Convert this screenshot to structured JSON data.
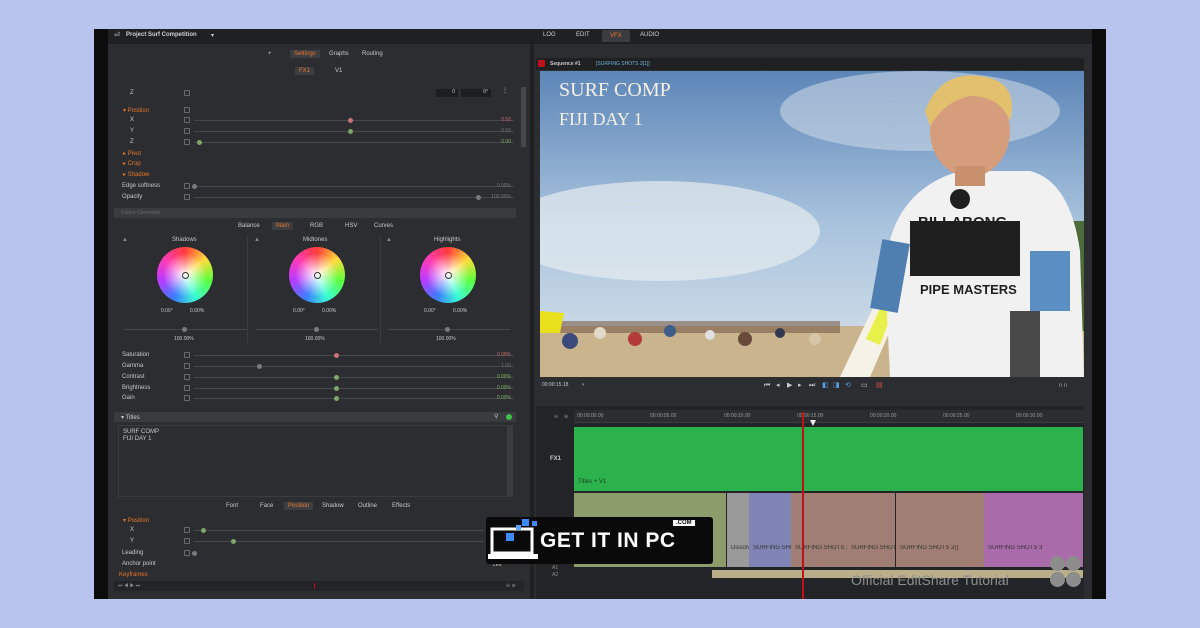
{
  "project_title": "Project Surf Competition",
  "top_tabs": [
    "LOG",
    "EDIT",
    "VFX",
    "AUDIO"
  ],
  "active_top_tab": "VFX",
  "panel_tabs": [
    "Settings",
    "Graphs",
    "Routing"
  ],
  "track_tabs": [
    "FX1",
    "V1"
  ],
  "z_row": {
    "label": "Z",
    "value1": "0",
    "value2": "0°"
  },
  "position_group": {
    "title": "Position",
    "rows": [
      {
        "label": "X",
        "value": "0.50"
      },
      {
        "label": "Y",
        "value": "0.50"
      },
      {
        "label": "Z",
        "value": "0.00"
      }
    ]
  },
  "collapsed_groups": [
    "Pivot",
    "Crop",
    "Shadow"
  ],
  "edge_softness": {
    "label": "Edge softness",
    "value": "0.00%"
  },
  "opacity": {
    "label": "Opacity",
    "value": "100.00%"
  },
  "colour_correction": {
    "title": "Colour Correction",
    "tabs": [
      "Balance",
      "Main",
      "RGB",
      "HSV",
      "Curves"
    ],
    "active_tab": "Main",
    "wheels": [
      {
        "name": "Shadows",
        "angle": "0.00°",
        "amount": "0.00%",
        "level": "100.00%"
      },
      {
        "name": "Midtones",
        "angle": "0.00°",
        "amount": "0.00%",
        "level": "100.00%"
      },
      {
        "name": "Highlights",
        "angle": "0.00°",
        "amount": "0.00%",
        "level": "100.00%"
      }
    ],
    "params": [
      {
        "label": "Saturation",
        "value": "0.00%"
      },
      {
        "label": "Gamma",
        "value": "1.00"
      },
      {
        "label": "Contrast",
        "value": "0.00%"
      },
      {
        "label": "Brightness",
        "value": "0.00%"
      },
      {
        "label": "Gain",
        "value": "0.00%"
      }
    ]
  },
  "titles": {
    "title": "Titles",
    "text_line1": "SURF COMP",
    "text_line2": "FIJI DAY 1",
    "tabs": [
      "Font",
      "Face",
      "Position",
      "Shadow",
      "Outline",
      "Effects"
    ],
    "active_tab": "Position",
    "position_label": "Position",
    "rows": [
      "X",
      "Y"
    ],
    "leading": "Leading",
    "anchor": "Anchor point",
    "anchor_value": "Left",
    "keyframes": "Keyframes"
  },
  "viewer": {
    "sequence": "Sequence #1",
    "clip": "[SURFING SHOTS 3[1]]",
    "overlay_line1": "SURF COMP",
    "overlay_line2": "FIJI DAY 1",
    "shirt_brand": "BILLABONG",
    "shirt_sub": "PIPE MASTERS",
    "timecode": "00:00:15.18"
  },
  "timeline": {
    "ruler": [
      "00:00:00.00",
      "00:00:05.00",
      "00:00:10.00",
      "00:00:15.00",
      "00:00:20.00",
      "00:00:25.00",
      "00:00:30.00"
    ],
    "track_label": "FX1",
    "fx_clip_label": "Titles + V1",
    "clips": [
      "Dissolv",
      "SURFING SHOTS",
      "SURFING SHOTS 2(",
      "SURFING SHOTS",
      "SURFING SHOTS 2()",
      "SURFING SHOTS 3"
    ],
    "track_numbers": [
      "A1",
      "A2"
    ]
  },
  "watermark": "Official EditShare Tutorial",
  "badge": {
    "text": "GET IT IN PC",
    "com": ".COM"
  },
  "colors": {
    "accent": "#e8762c",
    "green_track": "#2bb24c",
    "playhead": "#c0101a"
  }
}
